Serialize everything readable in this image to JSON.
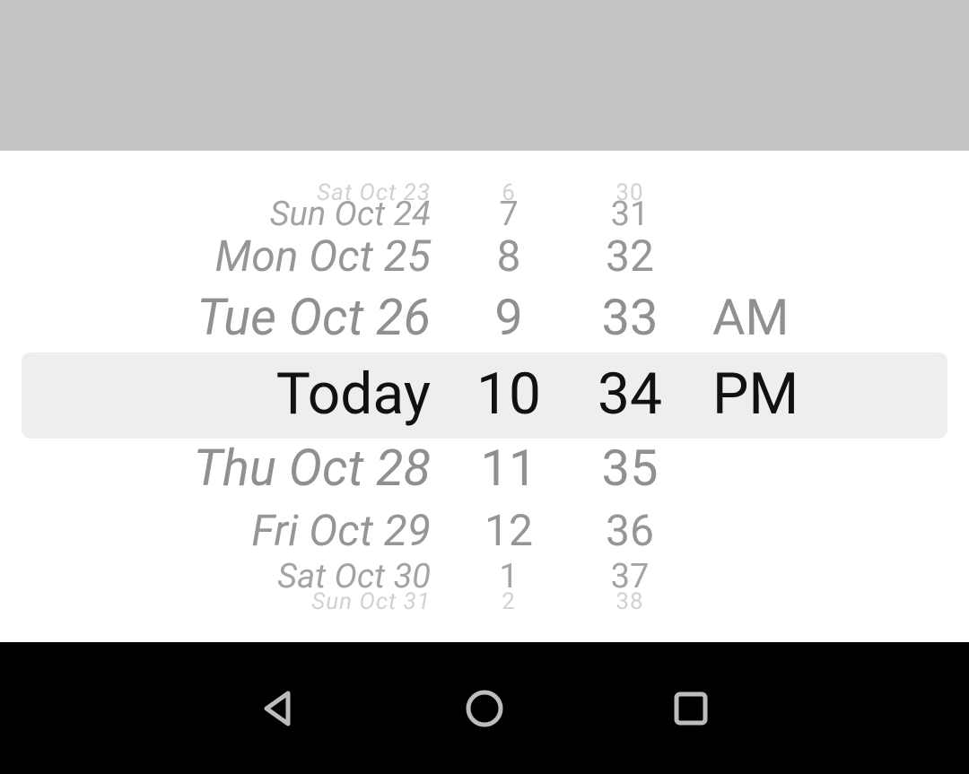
{
  "picker": {
    "selected": {
      "date": "Today",
      "hour": "10",
      "minute": "34",
      "ampm": "PM"
    },
    "date_wheel": [
      "Sat Oct 23",
      "Sun Oct 24",
      "Mon Oct 25",
      "Tue Oct 26",
      "Today",
      "Thu Oct 28",
      "Fri Oct 29",
      "Sat Oct 30",
      "Sun Oct 31"
    ],
    "hour_wheel": [
      "6",
      "7",
      "8",
      "9",
      "10",
      "11",
      "12",
      "1",
      "2"
    ],
    "minute_wheel": [
      "30",
      "31",
      "32",
      "33",
      "34",
      "35",
      "36",
      "37",
      "38"
    ],
    "ampm_wheel": [
      "AM",
      "PM"
    ]
  },
  "nav": {
    "back": "back",
    "home": "home",
    "recents": "recents"
  }
}
